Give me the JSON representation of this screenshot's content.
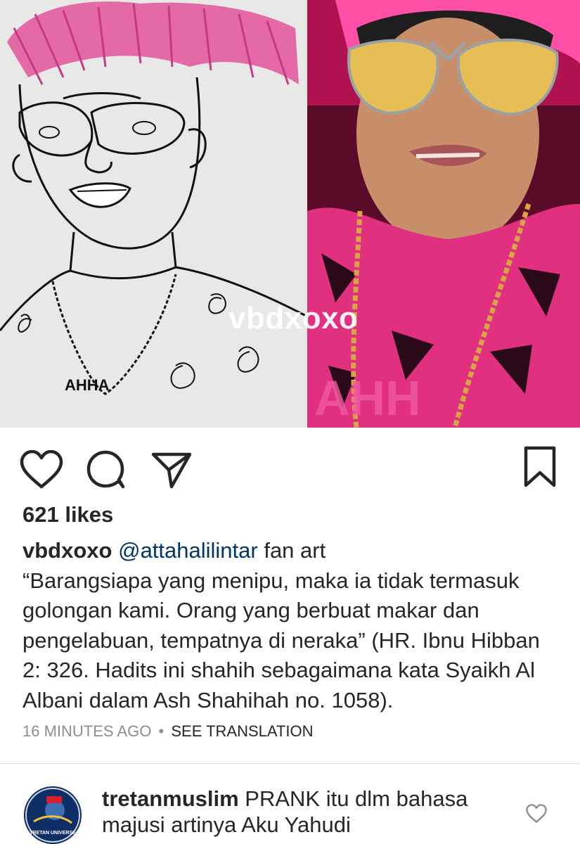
{
  "post": {
    "watermark": "vbdxoxo",
    "likes": "621 likes",
    "caption": {
      "username": "vbdxoxo",
      "mention": "@attahalilintar",
      "text": " fan art",
      "quote": "“Barangsiapa yang menipu, maka ia tidak termasuk golongan kami. Orang yang berbuat makar dan pengelabuan, tempatnya di neraka” (HR. Ibnu Hibban 2: 326. Hadits ini shahih sebagaimana kata Syaikh Al Albani dalam Ash Shahihah no. 1058)."
    },
    "timestamp": "16 MINUTES AGO",
    "separator": "•",
    "see_translation": "SEE TRANSLATION"
  },
  "icons": {
    "like": "heart-icon",
    "comment": "comment-bubble-icon",
    "share": "paper-plane-icon",
    "save": "bookmark-icon",
    "comment_like": "heart-icon"
  },
  "comment": {
    "username": "tretanmuslim",
    "text": " PRANK itu dlm bahasa majusi artinya Aku Yahudi",
    "avatar_text": "TRETAN UNIVERSE"
  },
  "colors": {
    "text": "#262626",
    "muted": "#8e8e8e",
    "mention": "#003569",
    "divider": "#dbdbdb",
    "hair_pink": "#e8509a"
  }
}
